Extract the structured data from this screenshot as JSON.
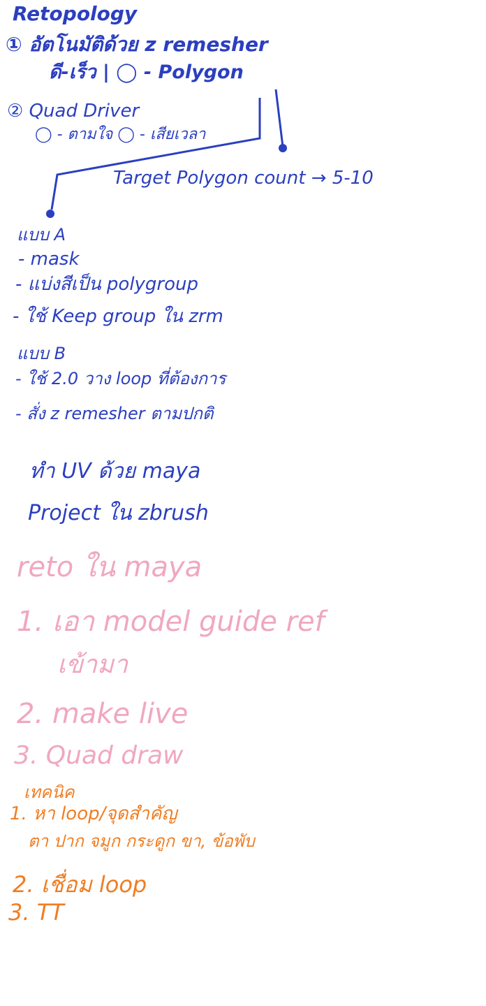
{
  "colors": {
    "blue_ink": "#2b3fbf",
    "pink_ink": "#f0a7c0",
    "orange_ink": "#f07d22",
    "paper": "#ffffff"
  },
  "section1": {
    "title": "Retopology",
    "step1_line1": "① อัตโนมัติด้วย z remesher",
    "step1_line2": "ดี-เร็ว | ◯ - Polygon",
    "step2_line1": "② Quad Driver",
    "step2_line2": "◯ - ตามใจ  ◯ - เสียเวลา",
    "target": "Target Polygon count → 5-10"
  },
  "section2": {
    "a_title": "แบบ A",
    "a_1": "- mask",
    "a_2": "- แบ่งสีเป็น polygroup",
    "a_3": "- ใช้ Keep group ใน zrm",
    "b_title": "แบบ B",
    "b_1": "- ใช้ 2.0 วาง loop ที่ต้องการ",
    "b_2": "- สั่ง z remesher ตามปกติ"
  },
  "section3": {
    "line1": "ทำ UV ด้วย maya",
    "line2": "Project ใน zbrush"
  },
  "section4": {
    "title": "reto ใน maya",
    "step1a": "1. เอา model guide ref",
    "step1b": "เข้ามา",
    "step2": "2. make live",
    "step3": "3. Quad draw"
  },
  "section5": {
    "title": "เทคนิค",
    "step1a": "1. หา loop/จุดสำคัญ",
    "step1b": "ตา ปาก จมูก กระดูก ขา, ข้อพับ",
    "step2": "2. เชื่อม loop",
    "step3": "3. TT"
  }
}
